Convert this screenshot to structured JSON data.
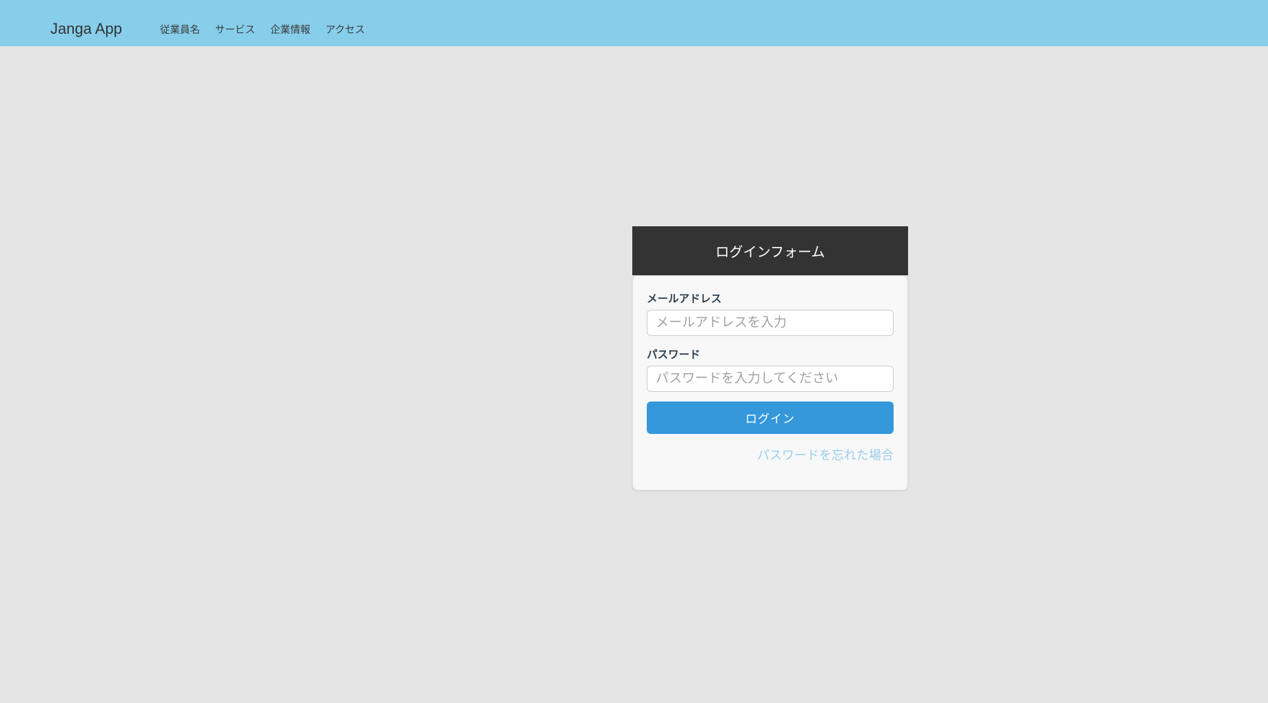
{
  "navbar": {
    "brand": "Janga App",
    "items": [
      {
        "label": "従業員名"
      },
      {
        "label": "サービス"
      },
      {
        "label": "企業情報"
      },
      {
        "label": "アクセス"
      }
    ]
  },
  "login": {
    "title": "ログインフォーム",
    "email_label": "メールアドレス",
    "email_placeholder": "メールアドレスを入力",
    "password_label": "パスワード",
    "password_placeholder": "パスワードを入力してください",
    "submit_label": "ログイン",
    "forgot_link": "パスワードを忘れた場合"
  },
  "colors": {
    "navbar_bg": "#87ceeb",
    "page_bg": "#e5e5e5",
    "card_header_bg": "#333333",
    "card_body_bg": "#f8f8f8",
    "button_bg": "#3498db",
    "link_color": "#9acfec",
    "label_color": "#2c3e50"
  }
}
